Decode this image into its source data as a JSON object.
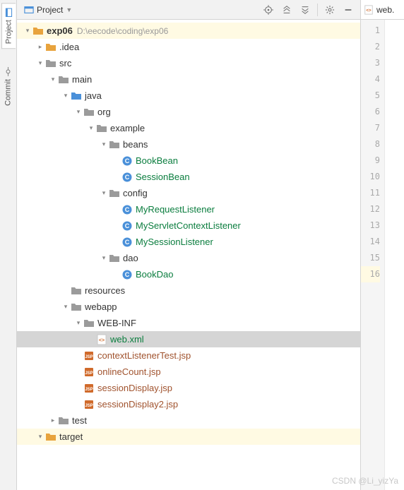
{
  "sideTabs": [
    {
      "id": "project",
      "label": "Project",
      "active": true
    },
    {
      "id": "commit",
      "label": "Commit",
      "active": false
    }
  ],
  "toolbar": {
    "viewLabel": "Project"
  },
  "editor": {
    "tabLabel": "web.",
    "lineCount": 16,
    "highlightLine": 16
  },
  "tree": [
    {
      "depth": 0,
      "arrow": "down",
      "icon": "folder-orange",
      "label": "exp06",
      "bold": true,
      "path": "D:\\eecode\\coding\\exp06",
      "hilite": true
    },
    {
      "depth": 1,
      "arrow": "right",
      "icon": "folder-orange",
      "label": ".idea"
    },
    {
      "depth": 1,
      "arrow": "down",
      "icon": "folder-gray",
      "label": "src"
    },
    {
      "depth": 2,
      "arrow": "down",
      "icon": "folder-gray",
      "label": "main"
    },
    {
      "depth": 3,
      "arrow": "down",
      "icon": "folder-blue",
      "label": "java"
    },
    {
      "depth": 4,
      "arrow": "down",
      "icon": "folder-gray",
      "label": "org"
    },
    {
      "depth": 5,
      "arrow": "down",
      "icon": "folder-gray",
      "label": "example"
    },
    {
      "depth": 6,
      "arrow": "down",
      "icon": "folder-gray",
      "label": "beans"
    },
    {
      "depth": 7,
      "arrow": "none",
      "icon": "class",
      "label": "BookBean",
      "green": true
    },
    {
      "depth": 7,
      "arrow": "none",
      "icon": "class",
      "label": "SessionBean",
      "green": true
    },
    {
      "depth": 6,
      "arrow": "down",
      "icon": "folder-gray",
      "label": "config"
    },
    {
      "depth": 7,
      "arrow": "none",
      "icon": "class",
      "label": "MyRequestListener",
      "green": true
    },
    {
      "depth": 7,
      "arrow": "none",
      "icon": "class",
      "label": "MyServletContextListener",
      "green": true
    },
    {
      "depth": 7,
      "arrow": "none",
      "icon": "class",
      "label": "MySessionListener",
      "green": true
    },
    {
      "depth": 6,
      "arrow": "down",
      "icon": "folder-gray",
      "label": "dao"
    },
    {
      "depth": 7,
      "arrow": "none",
      "icon": "class",
      "label": "BookDao",
      "green": true
    },
    {
      "depth": 3,
      "arrow": "none",
      "icon": "folder-gray",
      "label": "resources"
    },
    {
      "depth": 3,
      "arrow": "down",
      "icon": "folder-gray",
      "label": "webapp"
    },
    {
      "depth": 4,
      "arrow": "down",
      "icon": "folder-gray",
      "label": "WEB-INF"
    },
    {
      "depth": 5,
      "arrow": "none",
      "icon": "xml",
      "label": "web.xml",
      "green": true,
      "selected": true
    },
    {
      "depth": 4,
      "arrow": "none",
      "icon": "jsp",
      "label": "contextListenerTest.jsp",
      "brown": true
    },
    {
      "depth": 4,
      "arrow": "none",
      "icon": "jsp",
      "label": "onlineCount.jsp",
      "brown": true
    },
    {
      "depth": 4,
      "arrow": "none",
      "icon": "jsp",
      "label": "sessionDisplay.jsp",
      "brown": true
    },
    {
      "depth": 4,
      "arrow": "none",
      "icon": "jsp",
      "label": "sessionDisplay2.jsp",
      "brown": true
    },
    {
      "depth": 2,
      "arrow": "right",
      "icon": "folder-gray",
      "label": "test"
    },
    {
      "depth": 1,
      "arrow": "down",
      "icon": "folder-orange",
      "label": "target",
      "hilite": true
    }
  ],
  "watermark": "CSDN @Li_yizYa"
}
